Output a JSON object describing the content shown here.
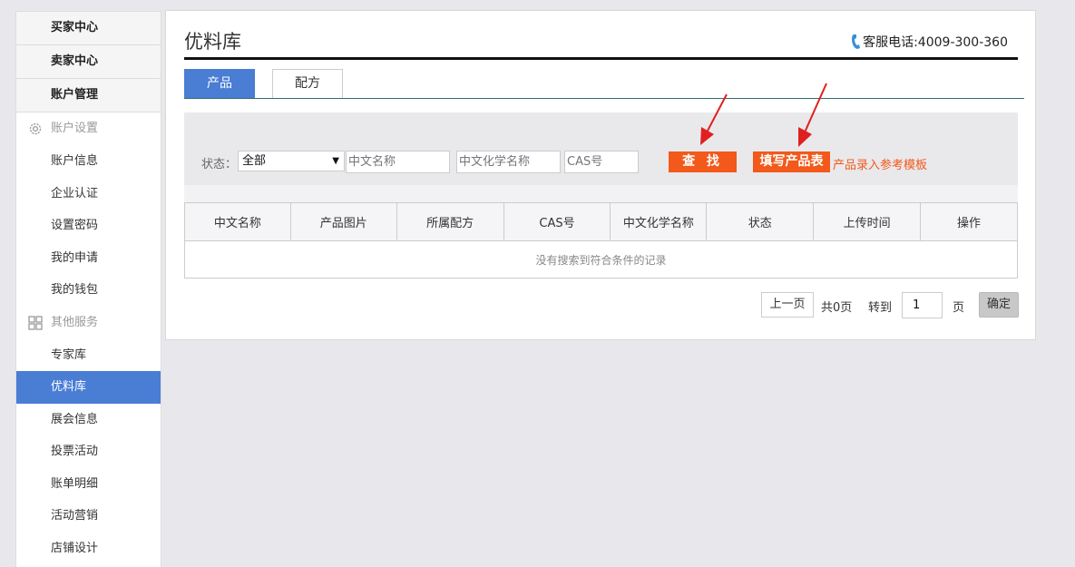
{
  "sidebar": {
    "top_items": [
      "买家中心",
      "卖家中心",
      "账户管理"
    ],
    "groups": [
      {
        "label": "账户设置",
        "icon": "gear-icon",
        "items": [
          "账户信息",
          "企业认证",
          "设置密码",
          "我的申请",
          "我的钱包"
        ]
      },
      {
        "label": "其他服务",
        "icon": "grid-icon",
        "items": [
          "专家库",
          "优料库",
          "展会信息",
          "投票活动",
          "账单明细",
          "活动营销",
          "店铺设计"
        ]
      }
    ],
    "active_item": "优料库"
  },
  "main": {
    "title": "优料库",
    "hotline": "客服电话:4009-300-360",
    "tabs": [
      {
        "label": "产品",
        "active": true
      },
      {
        "label": "配方",
        "active": false
      }
    ],
    "filter": {
      "status_label": "状态：",
      "status_value": "全部",
      "name_placeholder": "中文名称",
      "chem_placeholder": "中文化学名称",
      "cas_placeholder": "CAS号",
      "search_label": "查 找",
      "fill_label": "填写产品表",
      "template_link": "产品录入参考模板"
    },
    "table": {
      "headers": [
        "中文名称",
        "产品图片",
        "所属配方",
        "CAS号",
        "中文化学名称",
        "状态",
        "上传时间",
        "操作"
      ],
      "empty_text": "没有搜索到符合条件的记录"
    },
    "pager": {
      "prev": "上一页",
      "total": "共0页",
      "goto": "转到",
      "page_value": "1",
      "unit": "页",
      "ok": "确定"
    }
  },
  "colors": {
    "accent": "#4a7dd4",
    "orange": "#f2591b",
    "arrow": "#e02020"
  }
}
